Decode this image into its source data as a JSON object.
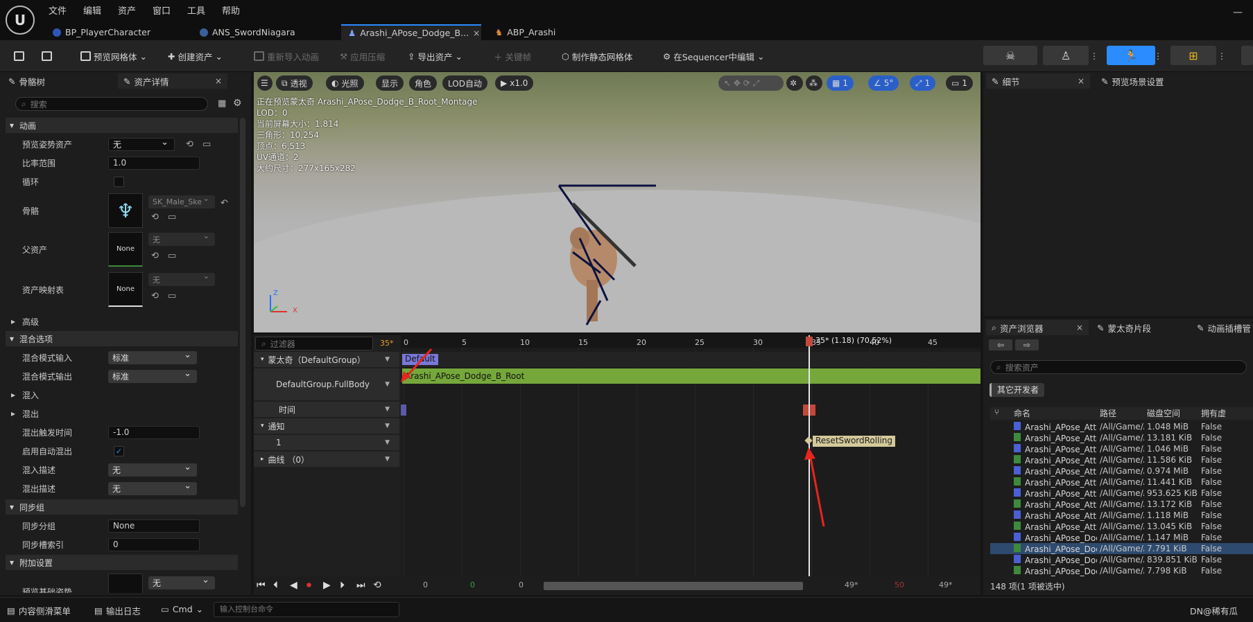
{
  "menu": [
    "文件",
    "编辑",
    "资产",
    "窗口",
    "工具",
    "帮助"
  ],
  "doc_tabs": [
    "BP_PlayerCharacter",
    "ANS_SwordNiagara",
    "Arashi_APose_Dodge_B...",
    "ABP_Arashi"
  ],
  "doc_tab_close": "×",
  "toolbar": {
    "preview_mesh": "预览网格体",
    "create_asset": "创建资产",
    "reimport": "重新导入动画",
    "apply_compression": "应用压缩",
    "export_asset": "导出资产",
    "keyframe": "关键帧",
    "make_static_mesh": "制作静态网格体",
    "edit_in_sequencer": "在Sequencer中编辑"
  },
  "left_panel": {
    "tab_skeleton": "骨骼树",
    "tab_details": "资产详情",
    "search_placeholder": "搜索",
    "sections": {
      "animation": "动画",
      "advanced": "高级",
      "blend_options": "混合选项",
      "blend_in": "混入",
      "blend_out": "混出",
      "sync_group": "同步组",
      "additive": "附加设置"
    },
    "rows": {
      "preview_pose_label": "预览姿势资产",
      "preview_pose_value": "无",
      "rate_scale_label": "比率范围",
      "rate_scale_value": "1.0",
      "loop_label": "循环",
      "skeleton_label": "骨骼",
      "skeleton_value": "SK_Male_Ske",
      "parent_label": "父资产",
      "parent_value": "无",
      "parent_thumb": "None",
      "asset_map_label": "资产映射表",
      "asset_map_value": "无",
      "asset_map_thumb": "None",
      "blend_in_mode_label": "混合模式输入",
      "blend_in_mode_value": "标准",
      "blend_out_mode_label": "混合模式输出",
      "blend_out_mode_value": "标准",
      "blend_out_trigger_label": "混出触发时间",
      "blend_out_trigger_value": "-1.0",
      "auto_blend_out_label": "启用自动混出",
      "blend_in_profile_label": "混入描述",
      "blend_in_profile_value": "无",
      "blend_out_profile_label": "混出描述",
      "blend_out_profile_value": "无",
      "sync_group_label": "同步分组",
      "sync_group_value": "None",
      "sync_slot_label": "同步槽索引",
      "sync_slot_value": "0",
      "ref_pose_label": "预览基础姿势",
      "ref_pose_value": "无"
    }
  },
  "viewport": {
    "view_mode": "透视",
    "lit": "光照",
    "show": "显示",
    "character": "角色",
    "lod": "LOD自动",
    "speed": "x1.0",
    "grid_value": "1",
    "angle_value": "5°",
    "scale_value": "1",
    "camera_value": "1",
    "info": [
      "正在预览蒙太奇 Arashi_APose_Dodge_B_Root_Montage",
      "LOD：0",
      "当前屏幕大小：1.814",
      "三角形：10,254",
      "顶点：6,513",
      "UV通道：2",
      "大约尺寸：277x165x282"
    ],
    "axis_z": "Z",
    "axis_x": "X"
  },
  "sequencer": {
    "filter_placeholder": "过滤器",
    "frame_badge": "35*",
    "tracks": {
      "montage": "蒙太奇（DefaultGroup）",
      "slot": "DefaultGroup.FullBody",
      "time": "时间",
      "notify": "通知",
      "notify_track": "1",
      "curves": "曲线 （0）"
    },
    "ticks": [
      "0",
      "5",
      "10",
      "15",
      "20",
      "25",
      "30",
      "35",
      "40",
      "45"
    ],
    "playhead_label": "35* (1.18) (70.52%)",
    "section_default": "Default",
    "segment_name": "Arashi_APose_Dodge_B_Root",
    "notify_name": "ResetSwordRolling",
    "play_numbers": [
      "0",
      "0",
      "0",
      "49*",
      "50",
      "49*"
    ]
  },
  "right_panel": {
    "tab_details": "细节",
    "tab_preview_scene": "预览场景设置"
  },
  "browser": {
    "tab_asset_browser": "资产浏览器",
    "tab_montage": "蒙太奇片段",
    "tab_anim_slots": "动画插槽管",
    "search_placeholder": "搜索资产",
    "filter_chip": "其它开发者",
    "columns": [
      "命名",
      "路径",
      "磁盘空间",
      "拥有虚"
    ],
    "rows": [
      {
        "name": "Arashi_APose_Attack",
        "path": "/All/Game/A",
        "size": "1.048 MiB",
        "flag": "False"
      },
      {
        "name": "Arashi_APose_Attack",
        "path": "/All/Game/A",
        "size": "13.181 KiB",
        "flag": "False"
      },
      {
        "name": "Arashi_APose_Attack",
        "path": "/All/Game/A",
        "size": "1.046 MiB",
        "flag": "False"
      },
      {
        "name": "Arashi_APose_Attack",
        "path": "/All/Game/A",
        "size": "11.586 KiB",
        "flag": "False"
      },
      {
        "name": "Arashi_APose_Attack",
        "path": "/All/Game/A",
        "size": "0.974 MiB",
        "flag": "False"
      },
      {
        "name": "Arashi_APose_Attack",
        "path": "/All/Game/A",
        "size": "11.441 KiB",
        "flag": "False"
      },
      {
        "name": "Arashi_APose_Attack",
        "path": "/All/Game/A",
        "size": "953.625 KiB",
        "flag": "False"
      },
      {
        "name": "Arashi_APose_Attack",
        "path": "/All/Game/A",
        "size": "13.172 KiB",
        "flag": "False"
      },
      {
        "name": "Arashi_APose_Attack",
        "path": "/All/Game/A",
        "size": "1.118 MiB",
        "flag": "False"
      },
      {
        "name": "Arashi_APose_Attack",
        "path": "/All/Game/A",
        "size": "13.045 KiB",
        "flag": "False"
      },
      {
        "name": "Arashi_APose_Dodge",
        "path": "/All/Game/A",
        "size": "1.147 MiB",
        "flag": "False"
      },
      {
        "name": "Arashi_APose_Dodge",
        "path": "/All/Game/A",
        "size": "7.791 KiB",
        "flag": "False"
      },
      {
        "name": "Arashi_APose_Dodge",
        "path": "/All/Game/A",
        "size": "839.851 KiB",
        "flag": "False"
      },
      {
        "name": "Arashi_APose_Dodge",
        "path": "/All/Game/A",
        "size": "7.798 KiB",
        "flag": "False"
      }
    ],
    "selected_row": 11,
    "status": "148 项(1 项被选中)"
  },
  "statusbar": {
    "content_drawer": "内容侧滑菜单",
    "output_log": "输出日志",
    "cmd": "Cmd",
    "console_placeholder": "输入控制台命令",
    "right_text": "DN@稀有瓜"
  },
  "colors": {
    "accent": "#2a8cff",
    "segment_green": "#75a73b",
    "notify_bg": "#d4c99a",
    "playhead_red": "#c24a3c",
    "arrow_red": "#e8251e"
  }
}
